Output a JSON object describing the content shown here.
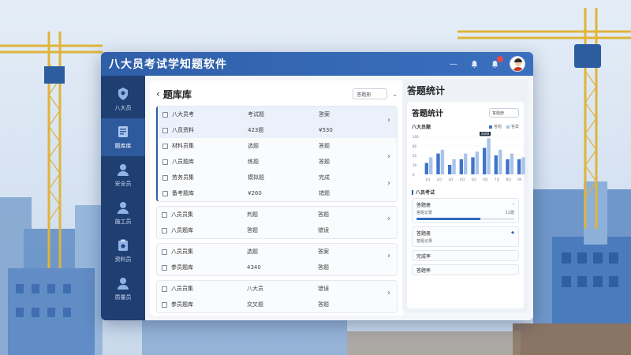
{
  "app": {
    "title": "八大员考试学知题软件"
  },
  "sidebar": {
    "items": [
      {
        "label": "八大员",
        "icon": "badge-icon",
        "active": false
      },
      {
        "label": "题库库",
        "icon": "document-icon",
        "active": true
      },
      {
        "label": "安全员",
        "icon": "user-icon",
        "active": false
      },
      {
        "label": "施工员",
        "icon": "user-icon",
        "active": false
      },
      {
        "label": "资料员",
        "icon": "clipboard-icon",
        "active": false
      },
      {
        "label": "质量员",
        "icon": "user-icon",
        "active": false
      }
    ]
  },
  "bank": {
    "title": "题库库",
    "select_value": "答题册",
    "groups": [
      {
        "rows": [
          [
            "八大员考",
            "考试题",
            "答案"
          ],
          [
            "八员资料",
            "423题",
            "¥530"
          ],
          [
            "材料员集",
            "选题",
            "答题"
          ],
          [
            "八员题库",
            "练题",
            "答题"
          ],
          [
            "劳务员集",
            "模拟题",
            "完成"
          ],
          [
            "备考题库",
            "¥260",
            "错题"
          ]
        ]
      },
      {
        "rows": [
          [
            "八员员集",
            "判题",
            "答题"
          ],
          [
            "八员题库",
            "答题",
            "错误"
          ]
        ]
      },
      {
        "rows": [
          [
            "八员员集",
            "选题",
            "答案"
          ],
          [
            "参员题库",
            "4340",
            "答题"
          ]
        ]
      },
      {
        "rows": [
          [
            "八员员集",
            "八大员",
            "错误"
          ],
          [
            "参员题库",
            "交叉题",
            "答题"
          ]
        ]
      }
    ]
  },
  "stats": {
    "title": "答题统计",
    "inner_title": "答题统计",
    "select_value": "答题册",
    "chart_title": "八大员题",
    "legend": [
      "答题",
      "答案"
    ],
    "sec_title": "八员考试",
    "cards": [
      {
        "k": "答题册",
        "v": "答题记录",
        "v2": "11题",
        "progress": 0.65
      },
      {
        "k": "答题册",
        "v": "答题记录"
      }
    ],
    "simple": [
      "完成率",
      "答题率"
    ]
  },
  "chart_data": {
    "type": "bar",
    "categories": [
      "1日",
      "2日",
      "3日",
      "4日",
      "5日",
      "6月",
      "7日",
      "8日",
      "9A"
    ],
    "series": [
      {
        "values": [
          30,
          55,
          25,
          40,
          45,
          70,
          50,
          40,
          40
        ]
      },
      {
        "values": [
          45,
          65,
          40,
          55,
          60,
          95,
          65,
          55,
          45
        ]
      }
    ],
    "ylim": [
      0,
      100
    ],
    "y_ticks": [
      "100",
      "80",
      "50",
      "30",
      "0"
    ],
    "annotation": "8488",
    "colors": [
      "#3f74c9",
      "#a9c4ea"
    ]
  },
  "colors": {
    "primary": "#2f5fa8",
    "sidebar": "#1f3f73",
    "accent_red": "#e84a4a"
  }
}
